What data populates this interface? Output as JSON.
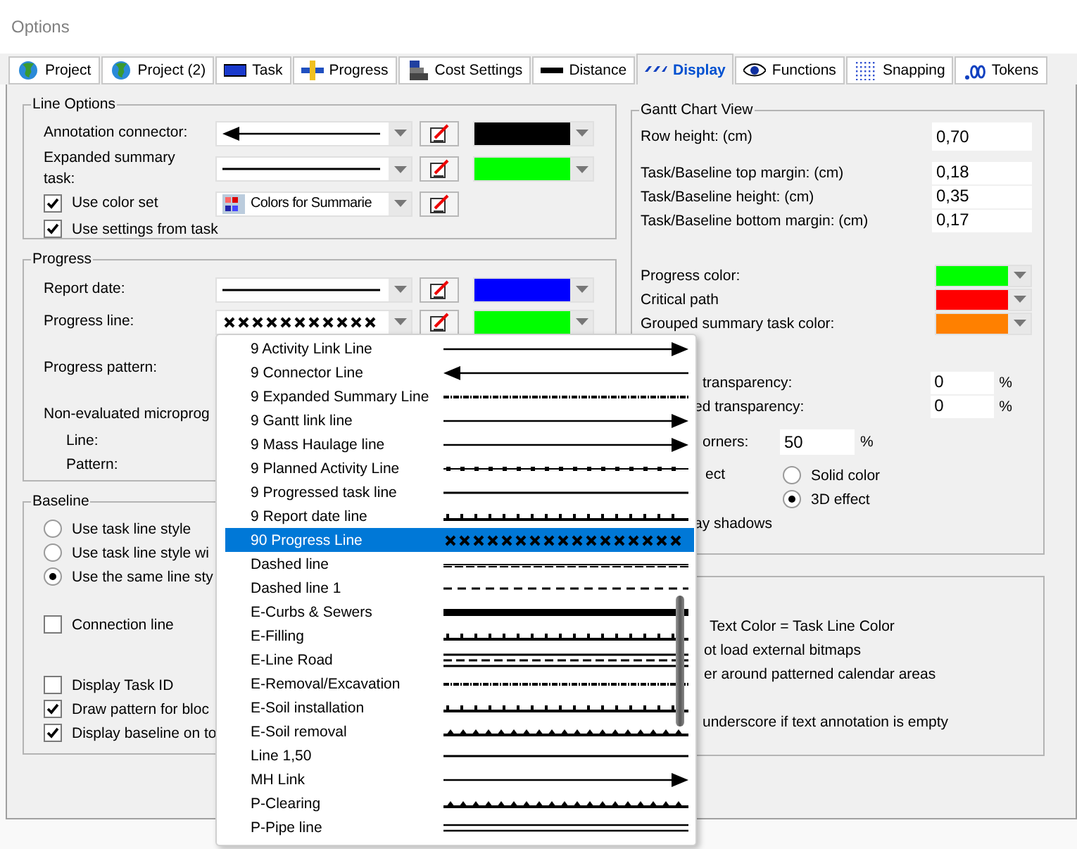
{
  "window": {
    "title": "Options"
  },
  "tabs": [
    {
      "label": "Project",
      "selected": false
    },
    {
      "label": "Project (2)",
      "selected": false
    },
    {
      "label": "Task",
      "selected": false
    },
    {
      "label": "Progress",
      "selected": false
    },
    {
      "label": "Cost Settings",
      "selected": false
    },
    {
      "label": "Distance",
      "selected": false
    },
    {
      "label": "Display",
      "selected": true
    },
    {
      "label": "Functions",
      "selected": false
    },
    {
      "label": "Snapping",
      "selected": false
    },
    {
      "label": "Tokens",
      "selected": false
    }
  ],
  "line_options": {
    "title": "Line Options",
    "rows": [
      {
        "label": "Annotation connector:",
        "kind": "arrow-left",
        "color": "#000000"
      },
      {
        "label": "Expanded summary task:",
        "kind": "plain",
        "color": "#00ff00"
      }
    ],
    "color_set": {
      "label": "Use color set",
      "checked": true,
      "value": "Colors for Summarie"
    },
    "use_settings": {
      "label": "Use settings from task",
      "checked": true
    }
  },
  "progress": {
    "title": "Progress",
    "rows": [
      {
        "label": "Report date:",
        "kind": "plain",
        "color": "#0000ff"
      },
      {
        "label": "Progress line:",
        "kind": "crosses",
        "color": "#00ff00"
      }
    ],
    "pattern_label": "Progress pattern:",
    "micro_label": "Non-evaluated microprog",
    "line_label": "Line:",
    "pattern2_label": "Pattern:"
  },
  "baseline": {
    "title": "Baseline",
    "styles": [
      {
        "label": "Use task line style",
        "selected": false
      },
      {
        "label": "Use task line style wi",
        "selected": false
      },
      {
        "label": "Use the same line sty",
        "selected": true
      }
    ],
    "connection": {
      "label": "Connection line",
      "checked": false
    },
    "options": [
      {
        "label": "Display Task ID",
        "checked": false
      },
      {
        "label": "Draw pattern for bloc",
        "checked": true
      },
      {
        "label": "Display baseline on to",
        "checked": true
      }
    ]
  },
  "gantt": {
    "title": "Gantt Chart View",
    "row_height": {
      "label": "Row height: (cm)",
      "value": "0,70"
    },
    "margins": [
      {
        "label": "Task/Baseline top margin: (cm)",
        "value": "0,18"
      },
      {
        "label": "Task/Baseline height: (cm)",
        "value": "0,35"
      },
      {
        "label": "Task/Baseline bottom margin: (cm)",
        "value": "0,17"
      }
    ],
    "colors": [
      {
        "label": "Progress color:",
        "color": "#00ff00"
      },
      {
        "label": "Critical path",
        "color": "#ff0000"
      },
      {
        "label": "Grouped summary task color:",
        "color": "#ff8000"
      }
    ],
    "transparency": [
      {
        "label": "transparency:",
        "value": "0",
        "unit": "%"
      },
      {
        "label": "ed transparency:",
        "value": "0",
        "unit": "%"
      }
    ],
    "corners": {
      "label": "orners:",
      "value": "50",
      "unit": "%"
    },
    "effect": {
      "label": "ect",
      "options": [
        {
          "label": "Solid color",
          "selected": false
        },
        {
          "label": "3D effect",
          "selected": true
        }
      ]
    },
    "shadows": {
      "label": "ay shadows"
    }
  },
  "misc": {
    "lines": [
      "Text Color = Task Line Color",
      "ot load external bitmaps",
      "er around patterned calendar areas",
      "underscore if text annotation is empty"
    ]
  },
  "dropdown": {
    "items": [
      {
        "label": "9 Activity Link Line",
        "kind": "arrow-right",
        "selected": false
      },
      {
        "label": "9 Connector Line",
        "kind": "arrow-left",
        "selected": false
      },
      {
        "label": "9 Expanded Summary Line",
        "kind": "dash-dot",
        "selected": false
      },
      {
        "label": "9 Gantt link line",
        "kind": "arrow-right",
        "selected": false
      },
      {
        "label": "9 Mass Haulage line",
        "kind": "arrow-right",
        "selected": false
      },
      {
        "label": "9 Planned Activity Line",
        "kind": "squares",
        "selected": false
      },
      {
        "label": "9 Progressed task line",
        "kind": "plain",
        "selected": false
      },
      {
        "label": "9 Report date line",
        "kind": "ticks",
        "selected": false
      },
      {
        "label": "90 Progress Line",
        "kind": "crosses",
        "selected": true
      },
      {
        "label": "Dashed line",
        "kind": "fine-dashed",
        "selected": false
      },
      {
        "label": "Dashed line 1",
        "kind": "dashed",
        "selected": false
      },
      {
        "label": "E-Curbs & Sewers",
        "kind": "thick",
        "selected": false
      },
      {
        "label": "E-Filling",
        "kind": "ticks",
        "selected": false
      },
      {
        "label": "E-Line Road",
        "kind": "road",
        "selected": false
      },
      {
        "label": "E-Removal/Excavation",
        "kind": "dash-dot",
        "selected": false
      },
      {
        "label": "E-Soil installation",
        "kind": "ticks",
        "selected": false
      },
      {
        "label": "E-Soil removal",
        "kind": "bumps",
        "selected": false
      },
      {
        "label": "Line 1,50",
        "kind": "plain",
        "selected": false
      },
      {
        "label": "MH Link",
        "kind": "arrow-right",
        "selected": false
      },
      {
        "label": "P-Clearing",
        "kind": "bumps",
        "selected": false
      },
      {
        "label": "P-Pipe line",
        "kind": "double",
        "selected": false
      }
    ]
  }
}
